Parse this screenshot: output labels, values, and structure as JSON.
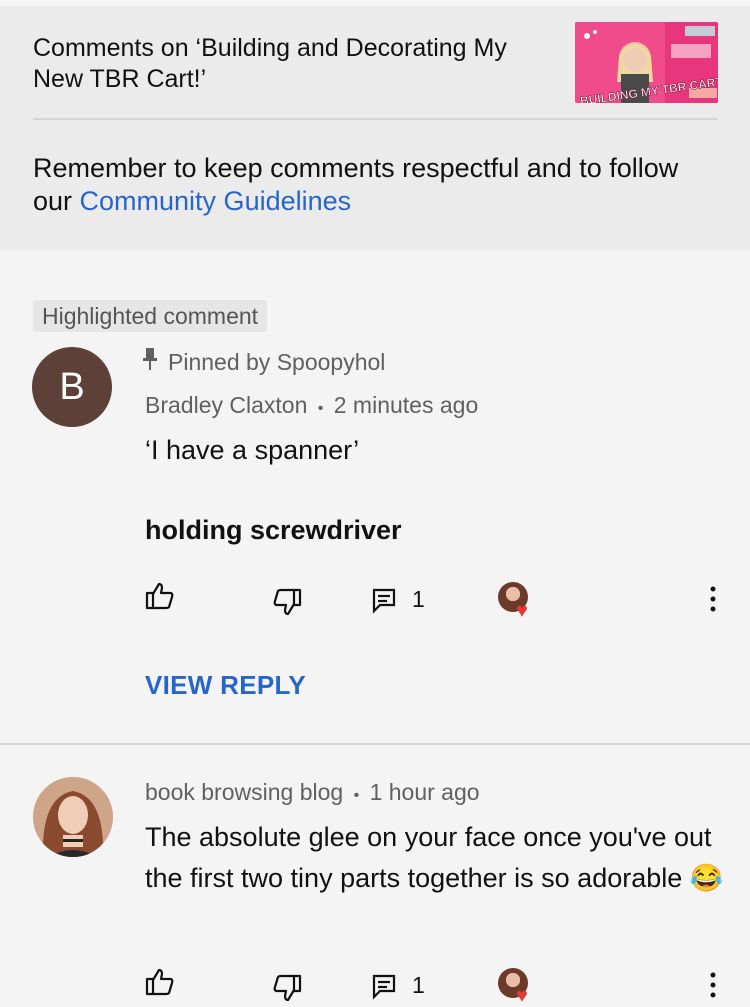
{
  "header": {
    "title": "Comments on ‘Building and Decorating My New TBR Cart!’",
    "thumbnail_text": "BUILDING MY TBR CART",
    "reminder_prefix": "Remember to keep comments respectful and to follow our ",
    "guidelines_link": "Community Guidelines"
  },
  "comments": [
    {
      "badge": "Highlighted comment",
      "avatar_letter": "B",
      "pinned_label": "Pinned by Spoopyhol",
      "author": "Bradley Claxton",
      "separator": "•",
      "time": "2 minutes ago",
      "line1": "‘I have a spanner’",
      "line2": "holding screwdriver",
      "reply_count": "1",
      "view_reply": "VIEW REPLY"
    },
    {
      "author": "book browsing blog",
      "separator": "•",
      "time": "1 hour ago",
      "text": "The absolute glee on your face once you've out the first two tiny parts together is so adorable 😂",
      "reply_count": "1"
    }
  ],
  "icons": [
    "pin-icon",
    "like-icon",
    "dislike-icon",
    "reply-icon",
    "heart-icon",
    "more-icon"
  ],
  "colors": {
    "link": "#2766c9",
    "heart": "#e53935",
    "thumbnail": "#f04b8b"
  }
}
